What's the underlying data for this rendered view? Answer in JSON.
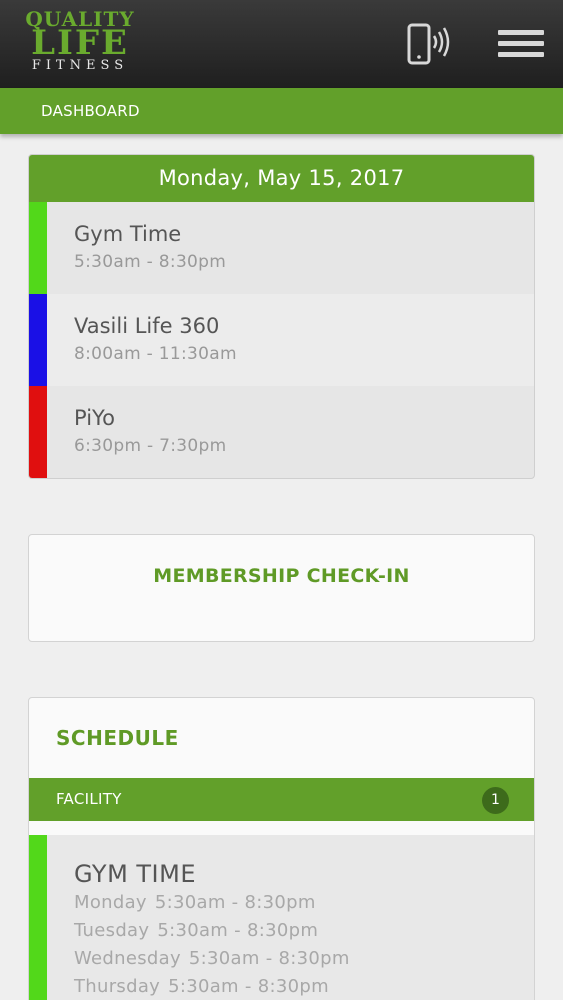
{
  "header": {
    "logo": {
      "line1": "QUALITY",
      "line2": "LIFE",
      "line3": "FITNESS"
    },
    "icons": {
      "phone": "phone-signal-icon",
      "menu": "hamburger-menu-icon"
    }
  },
  "nav": {
    "tab_label": "DASHBOARD"
  },
  "today": {
    "date": "Monday, May 15, 2017",
    "events": [
      {
        "name": "Gym Time",
        "time": "5:30am - 8:30pm",
        "color": "#52d81a"
      },
      {
        "name": "Vasili Life 360",
        "time": "8:00am - 11:30am",
        "color": "#1a10e6"
      },
      {
        "name": "PiYo",
        "time": "6:30pm - 7:30pm",
        "color": "#e00f0f"
      }
    ]
  },
  "checkin": {
    "label": "MEMBERSHIP CHECK-IN"
  },
  "schedule": {
    "title": "SCHEDULE",
    "facility": {
      "label": "FACILITY",
      "count": "1"
    },
    "item": {
      "name": "GYM TIME",
      "color": "#52d81a",
      "hours": [
        {
          "day": "Monday",
          "time": "5:30am - 8:30pm"
        },
        {
          "day": "Tuesday",
          "time": "5:30am - 8:30pm"
        },
        {
          "day": "Wednesday",
          "time": "5:30am - 8:30pm"
        },
        {
          "day": "Thursday",
          "time": "5:30am - 8:30pm"
        }
      ]
    }
  },
  "colors": {
    "brand_green": "#62a02a",
    "text_green": "#5f9a26"
  }
}
